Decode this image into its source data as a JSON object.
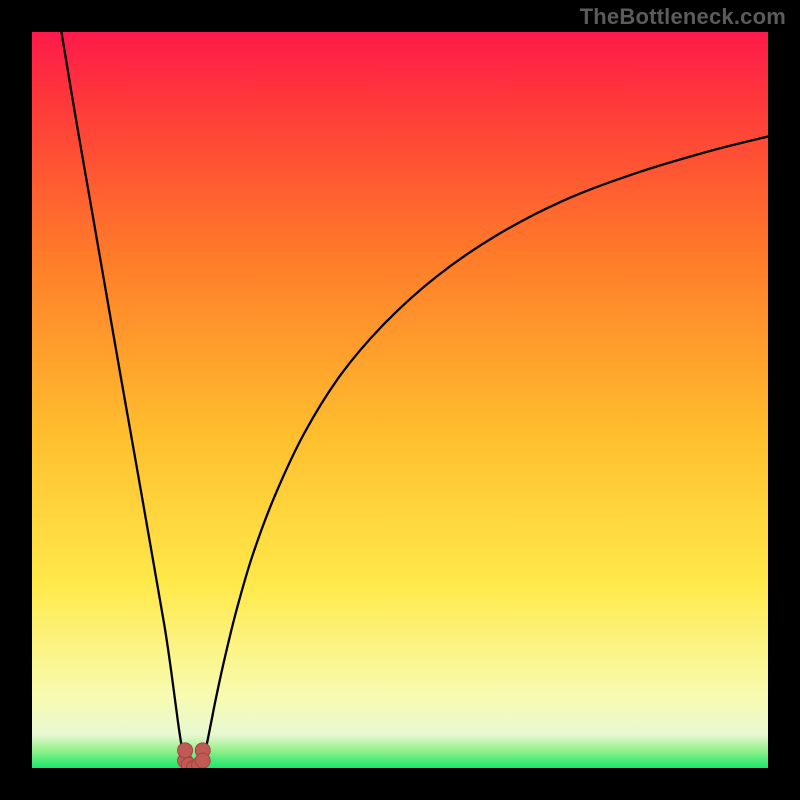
{
  "watermark": "TheBottleneck.com",
  "colors": {
    "page_bg": "#000000",
    "gradient_top": "#ff1a4b",
    "gradient_mid1": "#ff7a2a",
    "gradient_mid2": "#ffd633",
    "gradient_low": "#fdfccb",
    "gradient_bottom": "#17e86a",
    "curve": "#000000",
    "marker_fill": "#c05a54",
    "marker_stroke": "#a3453f"
  },
  "chart_data": {
    "type": "line",
    "title": "",
    "xlabel": "",
    "ylabel": "",
    "xlim": [
      0,
      100
    ],
    "ylim": [
      0,
      100
    ],
    "grid": false,
    "legend": false,
    "series": [
      {
        "name": "left-branch",
        "x": [
          4,
          6,
          8,
          10,
          12,
          14,
          16,
          18,
          19,
          19.8,
          20.3,
          20.8
        ],
        "y": [
          100,
          88,
          76.5,
          65,
          53.5,
          42.2,
          30.8,
          19.3,
          12.5,
          6.5,
          3.2,
          1.0
        ]
      },
      {
        "name": "right-branch",
        "x": [
          23.2,
          23.7,
          24.3,
          25.1,
          26.2,
          27.8,
          30,
          33,
          37,
          42,
          48,
          55,
          63,
          72,
          82,
          92,
          100
        ],
        "y": [
          1.0,
          3.0,
          6.0,
          10.0,
          15.0,
          21.5,
          29.0,
          37.0,
          45.5,
          53.5,
          60.5,
          66.8,
          72.3,
          77.0,
          80.8,
          83.8,
          85.8
        ]
      }
    ],
    "markers": [
      {
        "cx": 20.8,
        "cy": 1.0
      },
      {
        "cx": 20.8,
        "cy": 2.4
      },
      {
        "cx": 21.3,
        "cy": 0.4
      },
      {
        "cx": 22.0,
        "cy": 0.0
      },
      {
        "cx": 22.7,
        "cy": 0.4
      },
      {
        "cx": 23.2,
        "cy": 2.4
      },
      {
        "cx": 23.2,
        "cy": 1.0
      }
    ],
    "gradient_stops": [
      {
        "offset": 0.0,
        "color": "#ff1a4b"
      },
      {
        "offset": 0.1,
        "color": "#ff3a3a"
      },
      {
        "offset": 0.3,
        "color": "#ff7a2a"
      },
      {
        "offset": 0.55,
        "color": "#ffbf2e"
      },
      {
        "offset": 0.75,
        "color": "#ffe94a"
      },
      {
        "offset": 0.9,
        "color": "#f8fbb0"
      },
      {
        "offset": 0.955,
        "color": "#e8f8d0"
      },
      {
        "offset": 0.975,
        "color": "#99f08e"
      },
      {
        "offset": 1.0,
        "color": "#17e86a"
      }
    ]
  }
}
